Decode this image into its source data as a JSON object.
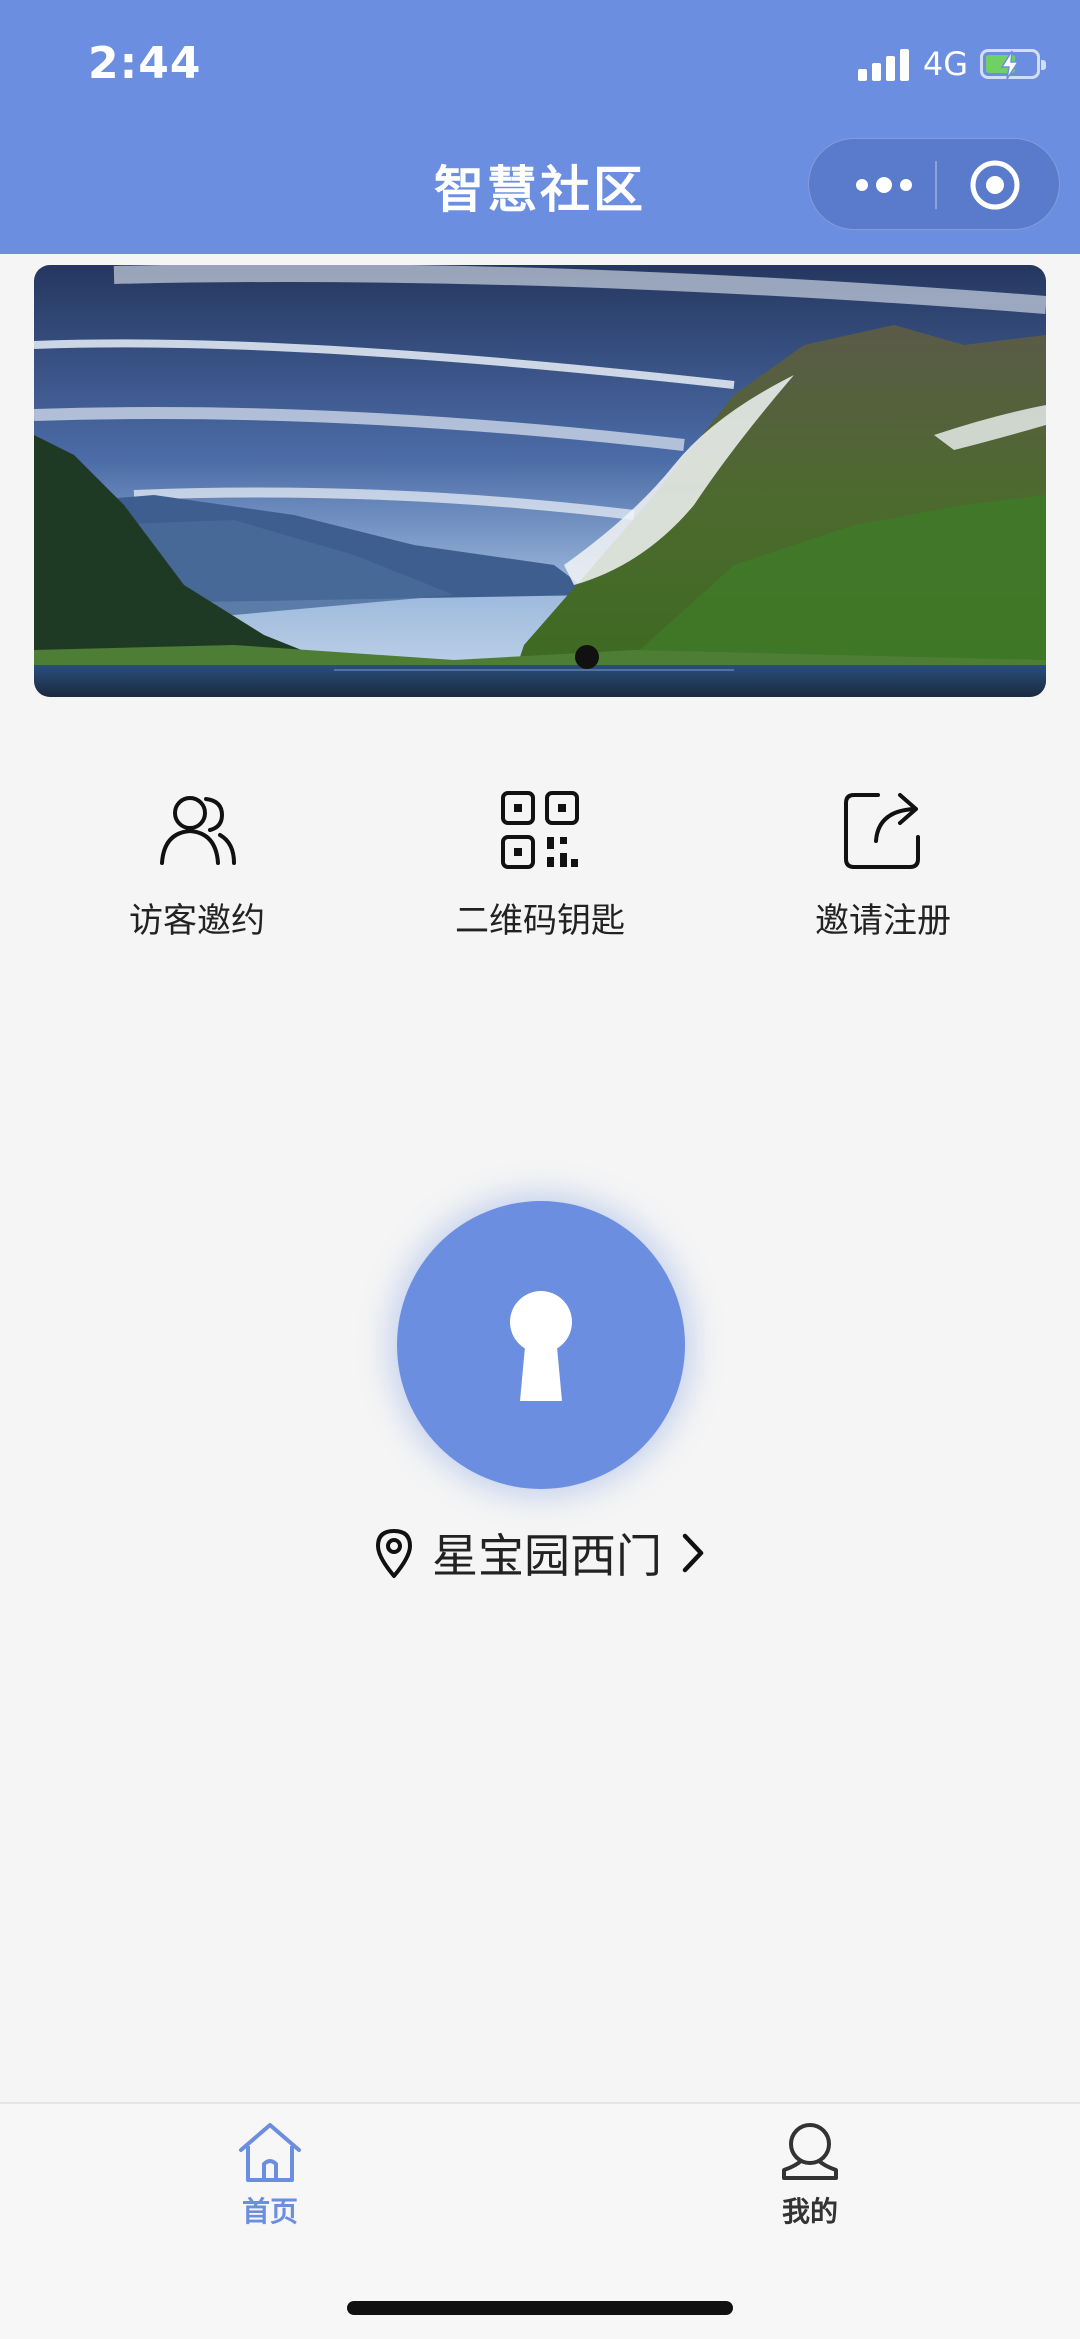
{
  "status_bar": {
    "time": "2:44",
    "network": "4G",
    "battery_level": 0.6
  },
  "nav": {
    "title": "智慧社区"
  },
  "banner": {
    "image_description": "mountain lake landscape",
    "active_slide": 1,
    "slide_count": 1
  },
  "features": [
    {
      "label": "访客邀约",
      "icon": "visitors-icon"
    },
    {
      "label": "二维码钥匙",
      "icon": "qr-code-icon"
    },
    {
      "label": "邀请注册",
      "icon": "share-icon"
    }
  ],
  "unlock": {
    "icon": "keyhole-icon",
    "location": "星宝园西门"
  },
  "tabbar": {
    "items": [
      {
        "label": "首页",
        "icon": "home-icon",
        "active": true
      },
      {
        "label": "我的",
        "icon": "profile-icon",
        "active": false
      }
    ],
    "active_color": "#6b8ee0",
    "inactive_color": "#333333"
  },
  "colors": {
    "primary": "#6b8ee0",
    "background": "#f5f5f5"
  }
}
